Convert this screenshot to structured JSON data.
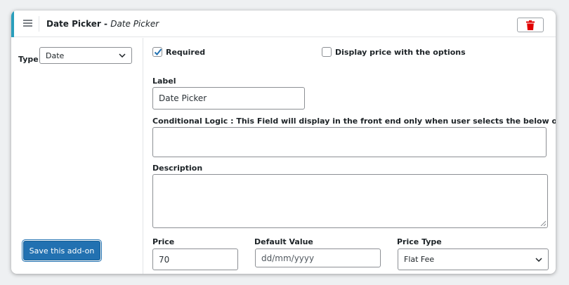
{
  "header": {
    "title": "Date Picker",
    "separator": " - ",
    "subtitle": "Date Picker",
    "accent_color": "#2a9fbc",
    "menu_icon": "hamburger-icon",
    "delete_icon": "trash-icon",
    "delete_color": "#e00000"
  },
  "left": {
    "type_label": "Type",
    "type_value": "Date",
    "save_label": "Save this add-on",
    "save_color": "#2271b1"
  },
  "options": {
    "required_label": "Required",
    "required_checked": true,
    "display_price_label": "Display price with the options",
    "display_price_checked": false
  },
  "fields": {
    "label_label": "Label",
    "label_value": "Date Picker",
    "conditional_label": "Conditional Logic : This Field will display in the front end only when user selects the below options",
    "conditional_value": "",
    "description_label": "Description",
    "description_value": "",
    "price_label": "Price",
    "price_value": "70",
    "default_label": "Default Value",
    "default_placeholder": "dd/mm/yyyy",
    "price_type_label": "Price Type",
    "price_type_value": "Flat Fee"
  }
}
